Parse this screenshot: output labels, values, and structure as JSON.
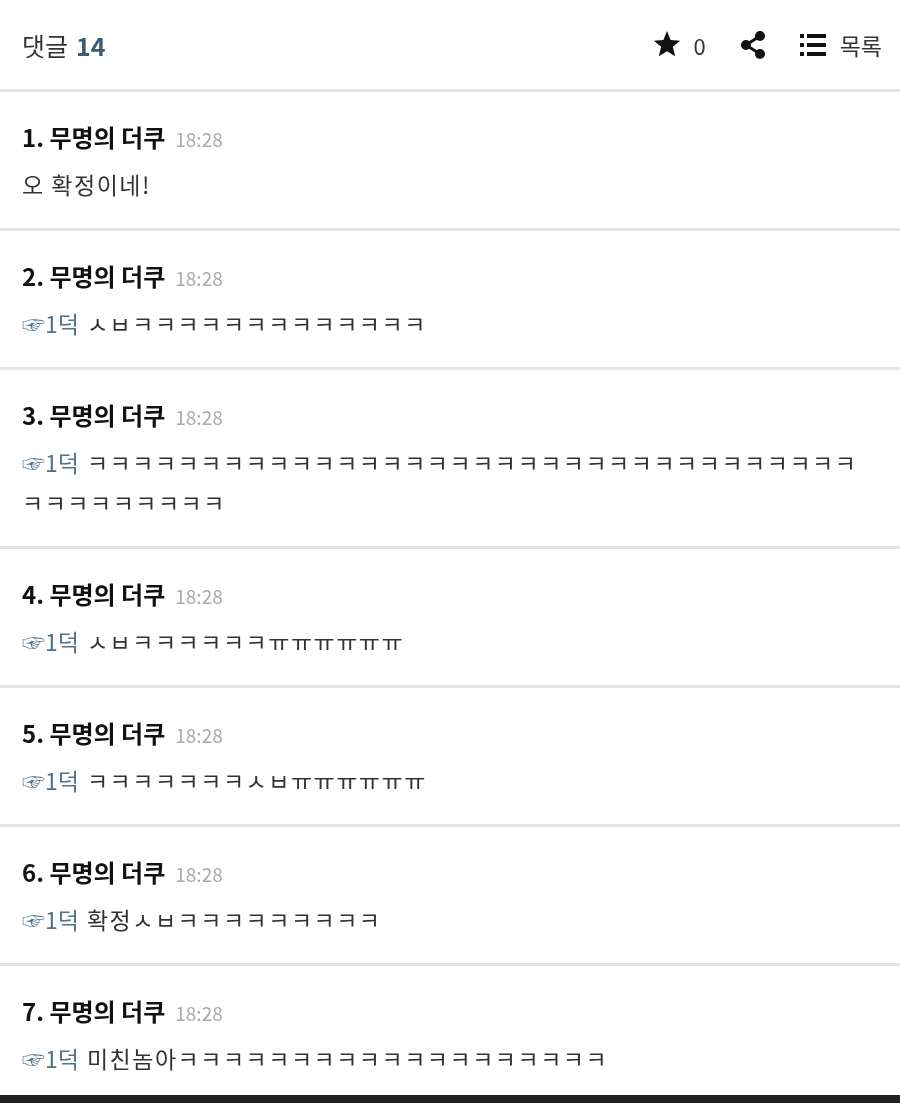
{
  "header": {
    "title": "댓글",
    "count": "14",
    "star_count": "0",
    "list_label": "목록"
  },
  "comments": [
    {
      "number": "1.",
      "author": "무명의 더쿠",
      "time": "18:28",
      "text": "오 확정이네!"
    },
    {
      "number": "2.",
      "author": "무명의 더쿠",
      "time": "18:28",
      "reply_to": "☞1덕",
      "text": "ㅅㅂㅋㅋㅋㅋㅋㅋㅋㅋㅋㅋㅋㅋㅋ"
    },
    {
      "number": "3.",
      "author": "무명의 더쿠",
      "time": "18:28",
      "reply_to": "☞1덕",
      "text": "ㅋㅋㅋㅋㅋㅋㅋㅋㅋㅋㅋㅋㅋㅋㅋㅋㅋㅋㅋㅋㅋㅋㅋㅋㅋㅋㅋㅋㅋㅋㅋㅋㅋㅋㅋㅋㅋㅋㅋㅋㅋㅋㅋ"
    },
    {
      "number": "4.",
      "author": "무명의 더쿠",
      "time": "18:28",
      "reply_to": "☞1덕",
      "text": "ㅅㅂㅋㅋㅋㅋㅋㅋㅠㅠㅠㅠㅠㅠ"
    },
    {
      "number": "5.",
      "author": "무명의 더쿠",
      "time": "18:28",
      "reply_to": "☞1덕",
      "text": "ㅋㅋㅋㅋㅋㅋㅋㅅㅂㅠㅠㅠㅠㅠㅠ"
    },
    {
      "number": "6.",
      "author": "무명의 더쿠",
      "time": "18:28",
      "reply_to": "☞1덕",
      "text": "확정ㅅㅂㅋㅋㅋㅋㅋㅋㅋㅋㅋ"
    },
    {
      "number": "7.",
      "author": "무명의 더쿠",
      "time": "18:28",
      "reply_to": "☞1덕",
      "text": "미친놈아ㅋㅋㅋㅋㅋㅋㅋㅋㅋㅋㅋㅋㅋㅋㅋㅋㅋㅋㅋ"
    }
  ]
}
